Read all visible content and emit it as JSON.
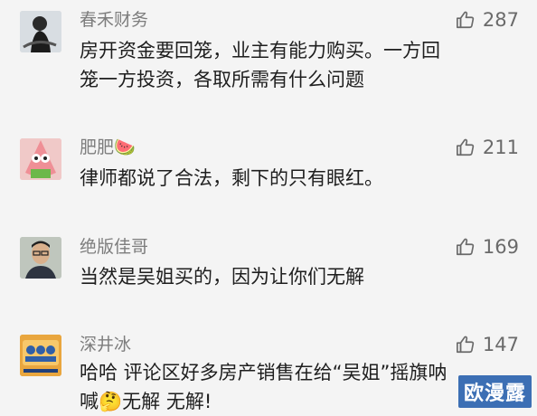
{
  "comments": [
    {
      "author": "春禾财务",
      "likes": "287",
      "lines": [
        "房开资金要回笼，业主有能力购买。一方回",
        "笼一方投资，各取所需有什么问题"
      ]
    },
    {
      "author": "肥肥",
      "author_emoji": "🍉",
      "likes": "211",
      "lines": [
        "律师都说了合法，剩下的只有眼红。"
      ]
    },
    {
      "author": "绝版佳哥",
      "likes": "169",
      "lines": [
        "当然是吴姐买的，因为让你们无解"
      ]
    },
    {
      "author": "深井冰",
      "likes": "147",
      "lines": [
        "哈哈 评论区好多房产销售在给“吴姐”摇旗呐",
        "喊"
      ],
      "line2_emoji": "🤔",
      "line2_tail": "无解 无解!"
    }
  ],
  "watermark": "欧漫露",
  "colors": {
    "background": "#f4f4f4",
    "name": "#7d7d7d",
    "text": "#1e1e1e",
    "like": "#6a6a6a",
    "watermark_bg": "#3c6fb4"
  },
  "icons": {
    "like": "thumbs-up-icon"
  }
}
